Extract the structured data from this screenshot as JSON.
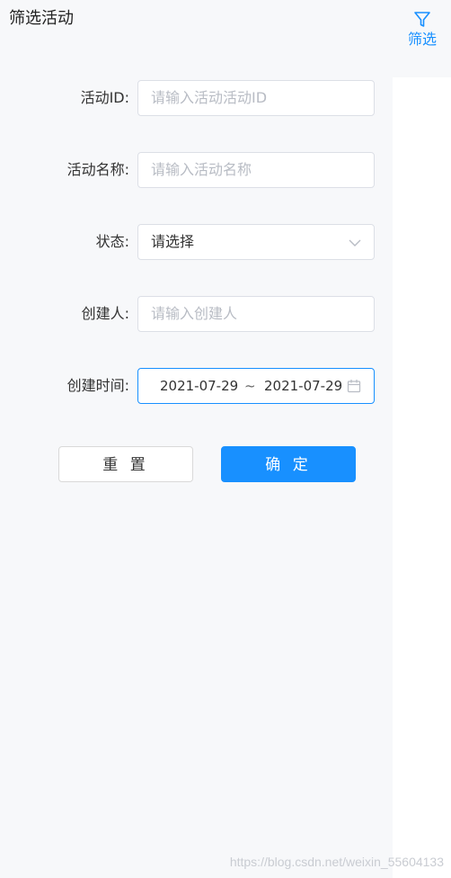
{
  "header": {
    "title": "筛选活动",
    "filter_label": "筛选",
    "filter_icon": "filter-icon"
  },
  "form": {
    "activity_id": {
      "label": "活动ID:",
      "placeholder": "请输入活动活动ID",
      "value": ""
    },
    "activity_name": {
      "label": "活动名称:",
      "placeholder": "请输入活动名称",
      "value": ""
    },
    "status": {
      "label": "状态:",
      "selected": "请选择",
      "icon": "chevron-down-icon"
    },
    "creator": {
      "label": "创建人:",
      "placeholder": "请输入创建人",
      "value": ""
    },
    "created_time": {
      "label": "创建时间:",
      "start": "2021-07-29",
      "separator": "~",
      "end": "2021-07-29",
      "icon": "calendar-icon"
    }
  },
  "actions": {
    "reset_label": "重 置",
    "confirm_label": "确 定"
  },
  "watermark": "https://blog.csdn.net/weixin_55604133",
  "colors": {
    "accent": "#1890ff",
    "page_bg": "#f7f8fa",
    "border": "#dcdfe6",
    "placeholder": "#b8bcc4"
  }
}
